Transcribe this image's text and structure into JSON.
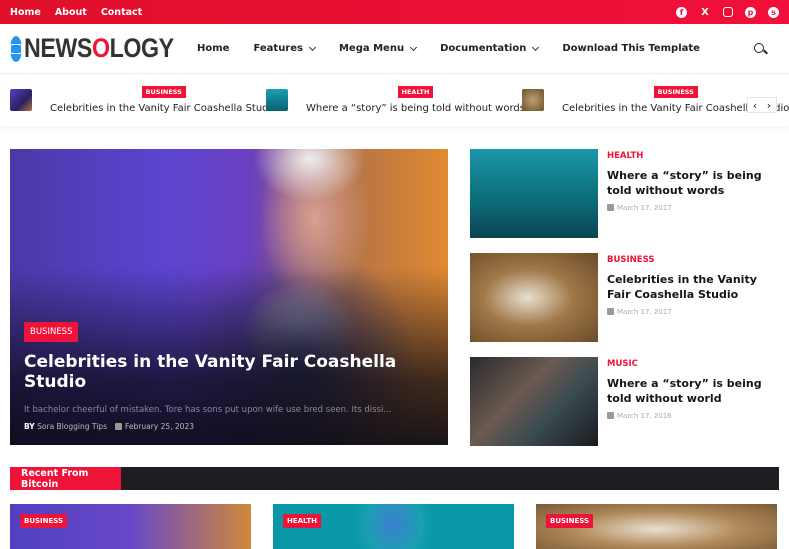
{
  "topbar": {
    "links": [
      "Home",
      "About",
      "Contact"
    ],
    "social": [
      "facebook-icon",
      "x-icon",
      "instagram-icon",
      "pinterest-icon",
      "skype-icon"
    ]
  },
  "header": {
    "logo_pre": "NEWS",
    "logo_accent": "O",
    "logo_post": "LOGY",
    "nav": [
      {
        "label": "Home",
        "dropdown": false
      },
      {
        "label": "Features",
        "dropdown": true
      },
      {
        "label": "Mega Menu",
        "dropdown": true
      },
      {
        "label": "Documentation",
        "dropdown": true
      },
      {
        "label": "Download This Template",
        "dropdown": false
      }
    ]
  },
  "ticker": {
    "items": [
      {
        "tag": "BUSINESS",
        "title": "Celebrities in the Vanity Fair Coashella Studio"
      },
      {
        "tag": "HEALTH",
        "title": "Where a “story” is being told without words"
      },
      {
        "tag": "BUSINESS",
        "title": "Celebrities in the Vanity Fair Coashella Studio"
      }
    ],
    "prev": "‹",
    "next": "›"
  },
  "hero": {
    "tag": "BUSINESS",
    "title": "Celebrities in the Vanity Fair Coashella Studio",
    "excerpt": "It bachelor cheerful of mistaken. Tore has sons put upon wife use bred seen. Its dissi...",
    "by": "BY",
    "author": "Sora Blogging Tips",
    "date": "February 25, 2023"
  },
  "side": [
    {
      "category": "HEALTH",
      "title": "Where a “story” is being told without words",
      "date": "March 17, 2017"
    },
    {
      "category": "BUSINESS",
      "title": "Celebrities in the Vanity Fair Coashella Studio",
      "date": "March 17, 2017"
    },
    {
      "category": "MUSIC",
      "title": "Where a “story” is being told without world",
      "date": "March 17, 2016"
    }
  ],
  "recent": {
    "heading": "Recent From Bitcoin",
    "cards": [
      {
        "tag": "BUSINESS"
      },
      {
        "tag": "HEALTH"
      },
      {
        "tag": "BUSINESS"
      }
    ]
  },
  "colors": {
    "accent": "#ee1338",
    "dark": "#1e1e22",
    "logo_blue": "#2196f3"
  }
}
